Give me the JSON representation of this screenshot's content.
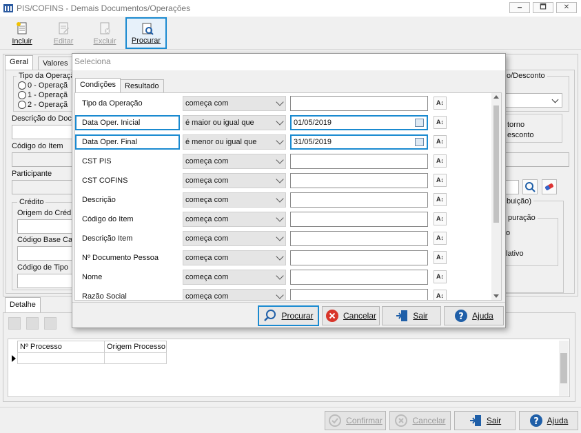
{
  "window": {
    "title": "PIS/COFINS - Demais Documentos/Operações",
    "minimize_label": "🗕",
    "maximize_label": "🗖",
    "close_label": "✕"
  },
  "toolbar": {
    "incluir": "Incluir",
    "editar": "Editar",
    "excluir": "Excluir",
    "procurar": "Procurar"
  },
  "bg_form": {
    "tabs": [
      "Geral",
      "Valores"
    ],
    "tipo_operacao_label": "Tipo da Operaçã",
    "radio_options": [
      "0 - Operaçã",
      "1 - Operaçã",
      "2 - Operaçã"
    ],
    "descricao_doc_label": "Descrição do Doc",
    "codigo_item_label": "Código do Item",
    "participante_label": "Participante",
    "credito_label": "Crédito",
    "origem_cred_label": "Origem do Créd",
    "codigo_base_label": "Código Base Ca",
    "codigo_tipo_label": "Código de Tipo",
    "right_desconto_label": "o/Desconto",
    "right_torno": "torno",
    "right_esconto": "esconto",
    "right_buicao": "buição)",
    "right_puracao": "puração",
    "right_o": "o",
    "right_lativo": "lativo"
  },
  "detalhe": {
    "tab": "Detalhe",
    "columns": [
      "Nº Processo",
      "Origem Processo"
    ]
  },
  "footer": {
    "confirmar": "Confirmar",
    "cancelar": "Cancelar",
    "sair": "Sair",
    "ajuda": "Ajuda"
  },
  "modal": {
    "title": "Seleciona",
    "tabs": [
      "Condições",
      "Resultado"
    ],
    "rows": [
      {
        "label": "Tipo da Operação",
        "operator": "começa com",
        "value": ""
      },
      {
        "label": "Data Oper. Inicial",
        "operator": "é maior ou igual que",
        "value": "01/05/2019"
      },
      {
        "label": "Data Oper. Final",
        "operator": "é menor ou igual que",
        "value": "31/05/2019"
      },
      {
        "label": "CST PIS",
        "operator": "começa com",
        "value": ""
      },
      {
        "label": "CST COFINS",
        "operator": "começa com",
        "value": ""
      },
      {
        "label": "Descrição",
        "operator": "começa com",
        "value": ""
      },
      {
        "label": "Código do Item",
        "operator": "começa com",
        "value": ""
      },
      {
        "label": "Descrição Item",
        "operator": "começa com",
        "value": ""
      },
      {
        "label": "Nº Documento Pessoa",
        "operator": "começa com",
        "value": ""
      },
      {
        "label": "Nome",
        "operator": "começa com",
        "value": ""
      },
      {
        "label": "Razão Social",
        "operator": "começa com",
        "value": ""
      }
    ],
    "buttons": {
      "procurar": "Procurar",
      "cancelar": "Cancelar",
      "sair": "Sair",
      "ajuda": "Ajuda"
    }
  }
}
